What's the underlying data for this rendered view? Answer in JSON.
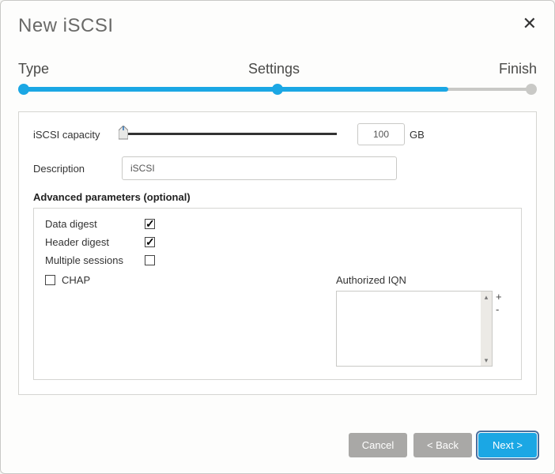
{
  "dialog": {
    "title": "New iSCSI"
  },
  "stepper": {
    "steps": [
      "Type",
      "Settings",
      "Finish"
    ]
  },
  "capacity": {
    "label": "iSCSI capacity",
    "value": "100",
    "unit": "GB"
  },
  "description": {
    "label": "Description",
    "value": "iSCSI"
  },
  "advanced": {
    "title": "Advanced parameters (optional)",
    "data_digest": {
      "label": "Data digest",
      "checked": true
    },
    "header_digest": {
      "label": "Header digest",
      "checked": true
    },
    "multiple_sessions": {
      "label": "Multiple sessions",
      "checked": false
    },
    "chap": {
      "label": "CHAP",
      "checked": false
    },
    "authorized_iqn": {
      "label": "Authorized IQN",
      "add": "+",
      "remove": "-"
    }
  },
  "footer": {
    "cancel": "Cancel",
    "back": "< Back",
    "next": "Next >"
  }
}
